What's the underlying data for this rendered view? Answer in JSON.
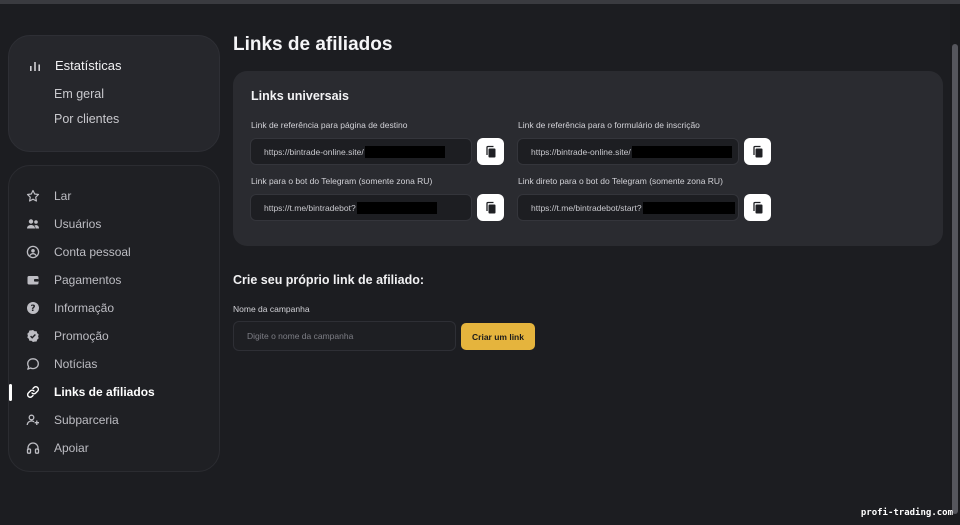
{
  "sidebar": {
    "stats": {
      "title": "Estatísticas",
      "items": [
        "Em geral",
        "Por clientes"
      ]
    },
    "nav": [
      {
        "label": "Lar",
        "icon": "star-icon"
      },
      {
        "label": "Usuários",
        "icon": "users-icon"
      },
      {
        "label": "Conta pessoal",
        "icon": "user-circle-icon"
      },
      {
        "label": "Pagamentos",
        "icon": "wallet-icon"
      },
      {
        "label": "Informação",
        "icon": "help-icon"
      },
      {
        "label": "Promoção",
        "icon": "badge-check-icon"
      },
      {
        "label": "Notícias",
        "icon": "chat-icon"
      },
      {
        "label": "Links de afiliados",
        "icon": "link-icon",
        "active": true
      },
      {
        "label": "Subparceria",
        "icon": "user-plus-icon"
      },
      {
        "label": "Apoiar",
        "icon": "headphones-icon"
      }
    ]
  },
  "page": {
    "title": "Links de afiliados"
  },
  "universal_links": {
    "title": "Links universais",
    "links": [
      {
        "label": "Link de referência para página de destino",
        "url": "https://bintrade-online.site/"
      },
      {
        "label": "Link de referência para o formulário de inscrição",
        "url": "https://bintrade-online.site/"
      },
      {
        "label": "Link para o bot do Telegram (somente zona RU)",
        "url": "https://t.me/bintradebot?"
      },
      {
        "label": "Link direto para o bot do Telegram (somente zona RU)",
        "url": "https://t.me/bintradebot/start?"
      }
    ]
  },
  "custom_link": {
    "title": "Crie seu próprio link de afiliado:",
    "campaign_label": "Nome da campanha",
    "campaign_placeholder": "Digite o nome da campanha",
    "campaign_value": "",
    "button_label": "Criar um link"
  },
  "watermark": "profi-trading.com",
  "colors": {
    "background": "#1c1d21",
    "card": "#2a2b30",
    "accent": "#e5b43d",
    "copy_button": "#ffffff"
  }
}
